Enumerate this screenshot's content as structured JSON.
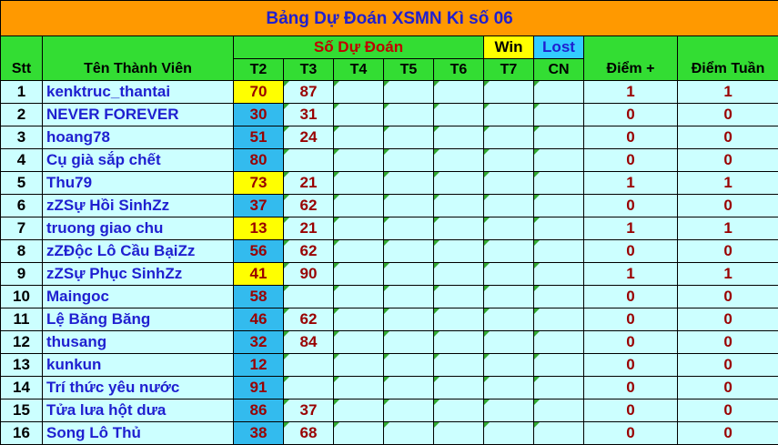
{
  "title": "Bảng Dự Đoán XSMN Kì số 06",
  "headers": {
    "stt": "Stt",
    "name": "Tên Thành Viên",
    "so_du_doan": "Số Dự Đoán",
    "win": "Win",
    "lost": "Lost",
    "days": [
      "T2",
      "T3",
      "T4",
      "T5",
      "T6",
      "T7",
      "CN"
    ],
    "diem_plus": "Điểm +",
    "diem_tuan": "Điểm Tuần"
  },
  "colors": {
    "title_bg": "#ff9900",
    "header_bg": "#33dd33",
    "row_bg": "#ccffff",
    "win_bg": "#ffff00",
    "lost_bg": "#33bbee",
    "name_text": "#1f1fd0",
    "number_text": "#990000"
  },
  "rows": [
    {
      "stt": "1",
      "name": "kenktruc_thantai",
      "t2": "70",
      "t2_win": true,
      "t3": "87",
      "diem_plus": "1",
      "diem_tuan": "1"
    },
    {
      "stt": "2",
      "name": "NEVER FOREVER",
      "t2": "30",
      "t2_win": false,
      "t3": "31",
      "diem_plus": "0",
      "diem_tuan": "0"
    },
    {
      "stt": "3",
      "name": "hoang78",
      "t2": "51",
      "t2_win": false,
      "t3": "24",
      "diem_plus": "0",
      "diem_tuan": "0"
    },
    {
      "stt": "4",
      "name": "Cụ già sắp chết",
      "t2": "80",
      "t2_win": false,
      "t3": "",
      "diem_plus": "0",
      "diem_tuan": "0"
    },
    {
      "stt": "5",
      "name": "Thu79",
      "t2": "73",
      "t2_win": true,
      "t3": "21",
      "diem_plus": "1",
      "diem_tuan": "1"
    },
    {
      "stt": "6",
      "name": "zZSự Hồi SinhZz",
      "t2": "37",
      "t2_win": false,
      "t3": "62",
      "diem_plus": "0",
      "diem_tuan": "0"
    },
    {
      "stt": "7",
      "name": "truong giao chu",
      "t2": "13",
      "t2_win": true,
      "t3": "21",
      "diem_plus": "1",
      "diem_tuan": "1"
    },
    {
      "stt": "8",
      "name": "zZĐộc Lô Cầu BạiZz",
      "t2": "56",
      "t2_win": false,
      "t3": "62",
      "diem_plus": "0",
      "diem_tuan": "0"
    },
    {
      "stt": "9",
      "name": "zZSự Phục SinhZz",
      "t2": "41",
      "t2_win": true,
      "t3": "90",
      "diem_plus": "1",
      "diem_tuan": "1"
    },
    {
      "stt": "10",
      "name": "Maingoc",
      "t2": "58",
      "t2_win": false,
      "t3": "",
      "diem_plus": "0",
      "diem_tuan": "0"
    },
    {
      "stt": "11",
      "name": "Lệ Băng Băng",
      "t2": "46",
      "t2_win": false,
      "t3": "62",
      "diem_plus": "0",
      "diem_tuan": "0"
    },
    {
      "stt": "12",
      "name": "thusang",
      "t2": "32",
      "t2_win": false,
      "t3": "84",
      "diem_plus": "0",
      "diem_tuan": "0"
    },
    {
      "stt": "13",
      "name": "kunkun",
      "t2": "12",
      "t2_win": false,
      "t3": "",
      "diem_plus": "0",
      "diem_tuan": "0"
    },
    {
      "stt": "14",
      "name": "Trí thức yêu nước",
      "t2": "91",
      "t2_win": false,
      "t3": "",
      "diem_plus": "0",
      "diem_tuan": "0"
    },
    {
      "stt": "15",
      "name": "Tửa lưa hột dưa",
      "t2": "86",
      "t2_win": false,
      "t3": "37",
      "diem_plus": "0",
      "diem_tuan": "0"
    },
    {
      "stt": "16",
      "name": "Song Lô Thủ",
      "t2": "38",
      "t2_win": false,
      "t3": "68",
      "diem_plus": "0",
      "diem_tuan": "0"
    }
  ]
}
